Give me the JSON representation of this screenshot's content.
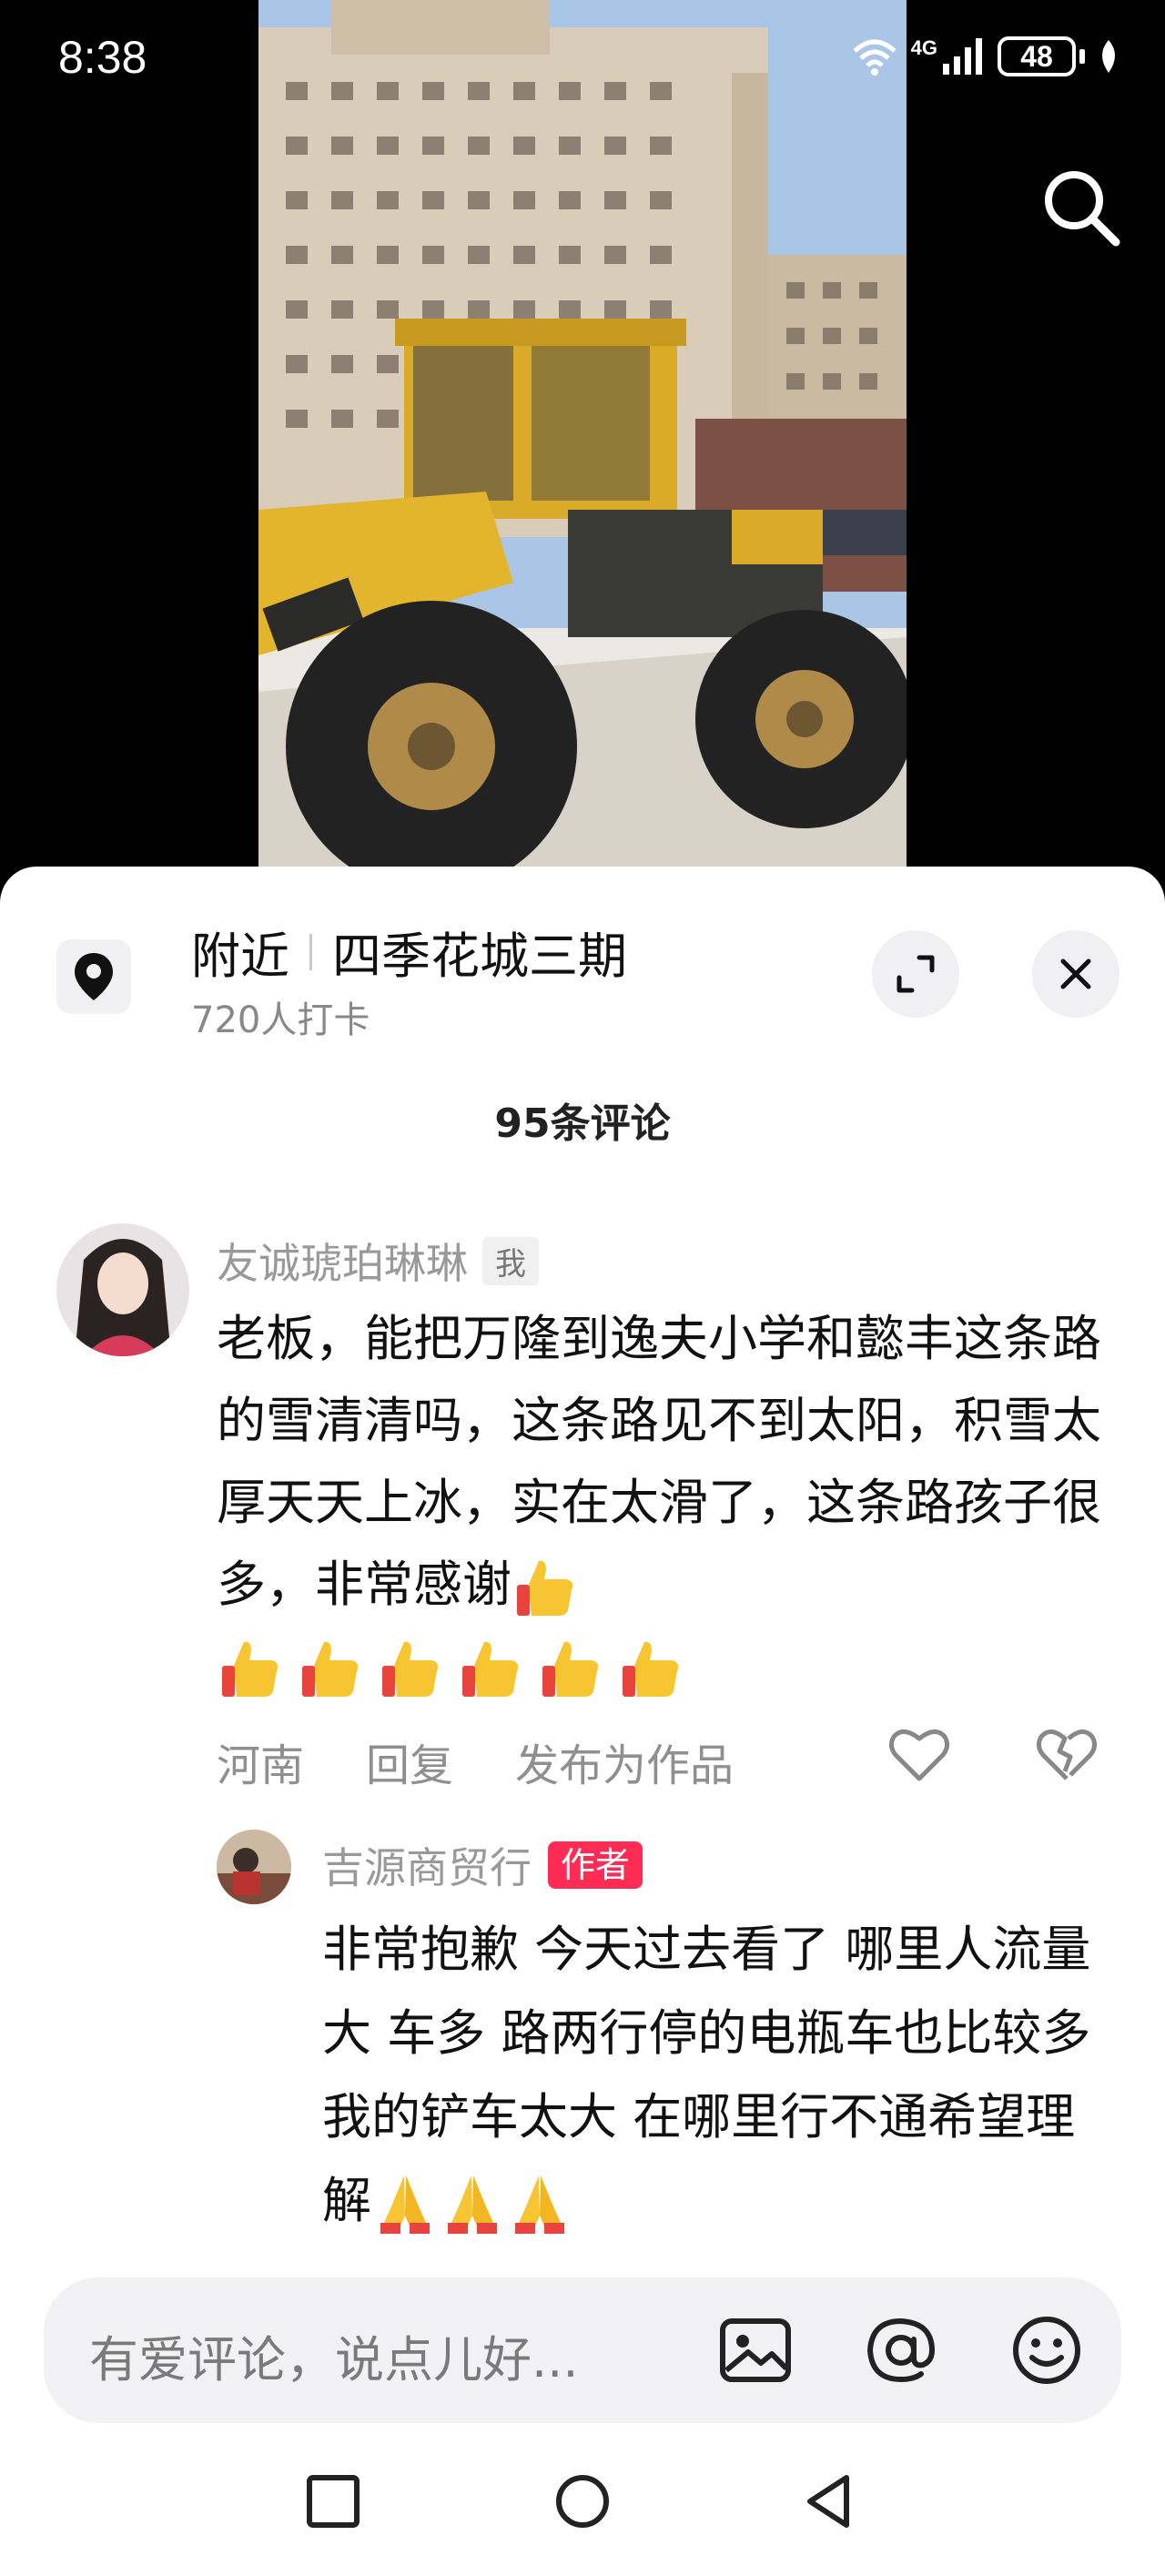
{
  "status_bar": {
    "time": "8:38",
    "network": "4G",
    "battery": "48"
  },
  "video": {
    "description_icons": [
      "search-icon"
    ]
  },
  "location": {
    "label": "附近",
    "place": "四季花城三期",
    "checkins": "720人打卡"
  },
  "comments_header": "95条评论",
  "comment": {
    "username": "友诚琥珀琳琳",
    "badge": "我",
    "text": "老板，能把万隆到逸夫小学和懿丰这条路的雪清清吗，这条路见不到太阳，积雪太厚天天上冰，实在太滑了，这条路孩子很多，非常感谢",
    "region": "河南",
    "reply_label": "回复",
    "publish_label": "发布为作品"
  },
  "reply": {
    "username": "吉源商贸行",
    "badge": "作者",
    "text": "非常抱歉 今天过去看了 哪里人流量大 车多 路两行停的电瓶车也比较多 我的铲车太大 在哪里行不通希望理解"
  },
  "input": {
    "placeholder": "有爱评论，说点儿好..."
  },
  "colors": {
    "accent": "#fe2c55",
    "sky": "#a9c6e6",
    "loader_yellow": "#d9ab28"
  }
}
